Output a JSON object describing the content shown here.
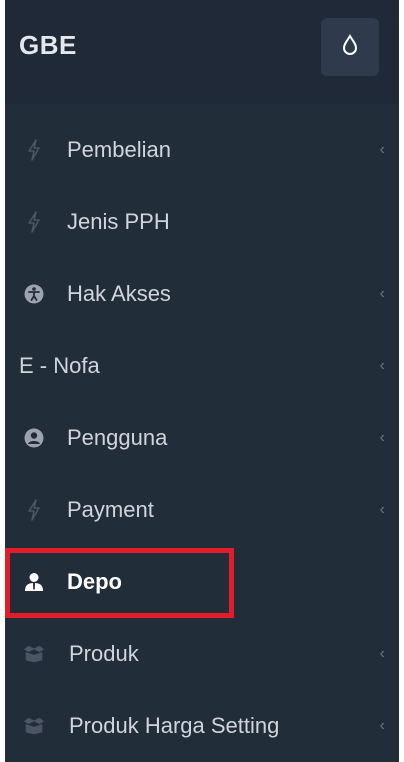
{
  "brand": {
    "name": "GBE"
  },
  "header": {
    "toggle_icon": "droplet-icon"
  },
  "menu": {
    "items": [
      {
        "label": "Pembelian",
        "icon": "bolt-icon",
        "has_submenu": true
      },
      {
        "label": "Jenis PPH",
        "icon": "bolt-icon",
        "has_submenu": false
      },
      {
        "label": "Hak Akses",
        "icon": "accessibility-icon",
        "has_submenu": true
      },
      {
        "label": "E - Nofa",
        "icon": "",
        "has_submenu": true
      },
      {
        "label": "Pengguna",
        "icon": "user-circle-icon",
        "has_submenu": true
      },
      {
        "label": "Payment",
        "icon": "bolt-icon",
        "has_submenu": true
      },
      {
        "label": "Depo",
        "icon": "user-tie-icon",
        "has_submenu": false,
        "active": true
      },
      {
        "label": "Produk",
        "icon": "box-icon",
        "has_submenu": true
      },
      {
        "label": "Produk Harga Setting",
        "icon": "box-icon",
        "has_submenu": true
      }
    ],
    "chevron": "‹"
  },
  "colors": {
    "sidebar_bg": "#222d3a",
    "header_bg": "#1f2937",
    "highlight": "#e11d2a"
  }
}
